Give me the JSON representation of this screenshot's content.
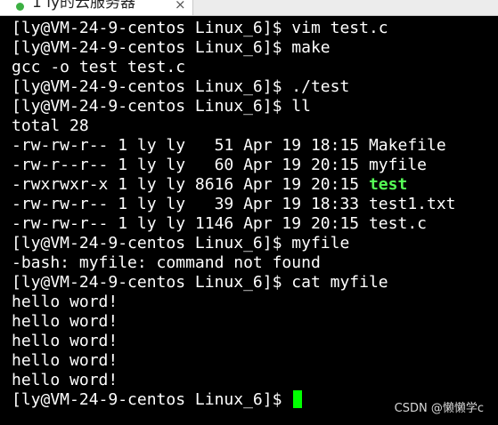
{
  "tab": {
    "title": "1 ly的云服务器",
    "close_label": "×"
  },
  "terminal": {
    "lines": [
      "[ly@VM-24-9-centos Linux_6]$ vim test.c",
      "[ly@VM-24-9-centos Linux_6]$ make",
      "gcc -o test test.c",
      "[ly@VM-24-9-centos Linux_6]$ ./test",
      "[ly@VM-24-9-centos Linux_6]$ ll",
      "total 28",
      "-rw-rw-r-- 1 ly ly   51 Apr 19 18:15 Makefile",
      "-rw-r--r-- 1 ly ly   60 Apr 19 20:15 myfile",
      "-rwxrwxr-x 1 ly ly 8616 Apr 19 20:15 ",
      "-rw-rw-r-- 1 ly ly   39 Apr 19 18:33 test1.txt",
      "-rw-rw-r-- 1 ly ly 1146 Apr 19 20:15 test.c",
      "[ly@VM-24-9-centos Linux_6]$ myfile",
      "-bash: myfile: command not found",
      "[ly@VM-24-9-centos Linux_6]$ cat myfile",
      "hello word!",
      "hello word!",
      "hello word!",
      "hello word!",
      "hello word!",
      "[ly@VM-24-9-centos Linux_6]$ "
    ],
    "executable_name": "test",
    "executable_color": "#55ff55",
    "cursor_color": "#00ff00"
  },
  "watermark": "CSDN @懒懒学c"
}
